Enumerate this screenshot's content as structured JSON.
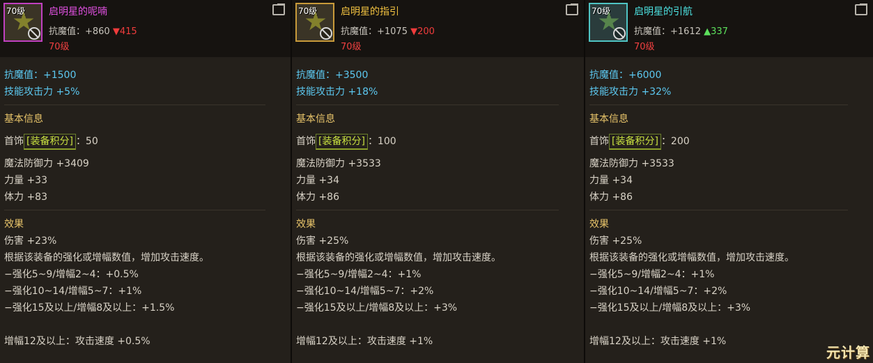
{
  "items": [
    {
      "level_tag": "70级",
      "name": "启明星的呢喃",
      "resist_label": "抗魔值：+860",
      "resist_diff": "▼415",
      "diff_dir": "down",
      "req_level": "70级",
      "stat_resist": "抗魔值：+1500",
      "stat_skill": "技能攻击力 +5%",
      "basic_title": "基本信息",
      "slot": "首饰",
      "score_tag": "[装备积分]",
      "score_value": "：50",
      "magic_def": "魔法防御力 +3409",
      "strength": "力量 +33",
      "vitality": "体力 +83",
      "effect_title": "效果",
      "damage": "伤害 +23%",
      "desc": "根据该装备的强化或增幅数值，增加攻击速度。",
      "tier1": "−强化5~9/增幅2~4：+0.5%",
      "tier2": "−强化10~14/增幅5~7：+1%",
      "tier3": "−强化15及以上/增幅8及以上：+1.5%",
      "bonus": "增幅12及以上：攻击速度 +0.5%"
    },
    {
      "level_tag": "70级",
      "name": "启明星的指引",
      "resist_label": "抗魔值：+1075",
      "resist_diff": "▼200",
      "diff_dir": "down",
      "req_level": "70级",
      "stat_resist": "抗魔值：+3500",
      "stat_skill": "技能攻击力 +18%",
      "basic_title": "基本信息",
      "slot": "首饰",
      "score_tag": "[装备积分]",
      "score_value": "：100",
      "magic_def": "魔法防御力 +3533",
      "strength": "力量 +34",
      "vitality": "体力 +86",
      "effect_title": "效果",
      "damage": "伤害 +25%",
      "desc": "根据该装备的强化或增幅数值，增加攻击速度。",
      "tier1": "−强化5~9/增幅2~4：+1%",
      "tier2": "−强化10~14/增幅5~7：+2%",
      "tier3": "−强化15及以上/增幅8及以上：+3%",
      "bonus": "增幅12及以上：攻击速度 +1%"
    },
    {
      "level_tag": "70级",
      "name": "启明星的引航",
      "resist_label": "抗魔值：+1612",
      "resist_diff": "▲337",
      "diff_dir": "up",
      "req_level": "70级",
      "stat_resist": "抗魔值：+6000",
      "stat_skill": "技能攻击力 +32%",
      "basic_title": "基本信息",
      "slot": "首饰",
      "score_tag": "[装备积分]",
      "score_value": "：200",
      "magic_def": "魔法防御力 +3533",
      "strength": "力量 +34",
      "vitality": "体力 +86",
      "effect_title": "效果",
      "damage": "伤害 +25%",
      "desc": "根据该装备的强化或增幅数值，增加攻击速度。",
      "tier1": "−强化5~9/增幅2~4：+1%",
      "tier2": "−强化10~14/增幅5~7：+2%",
      "tier3": "−强化15及以上/增幅8及以上：+3%",
      "bonus": "增幅12及以上：攻击速度 +1%"
    }
  ],
  "watermark": "元计算",
  "colors": {
    "epic_name": "#e050e0",
    "legendary_name": "#f0c040",
    "myth_name": "#4ce0e0",
    "diff_down": "#f03c3c",
    "diff_up": "#5ce05c"
  }
}
